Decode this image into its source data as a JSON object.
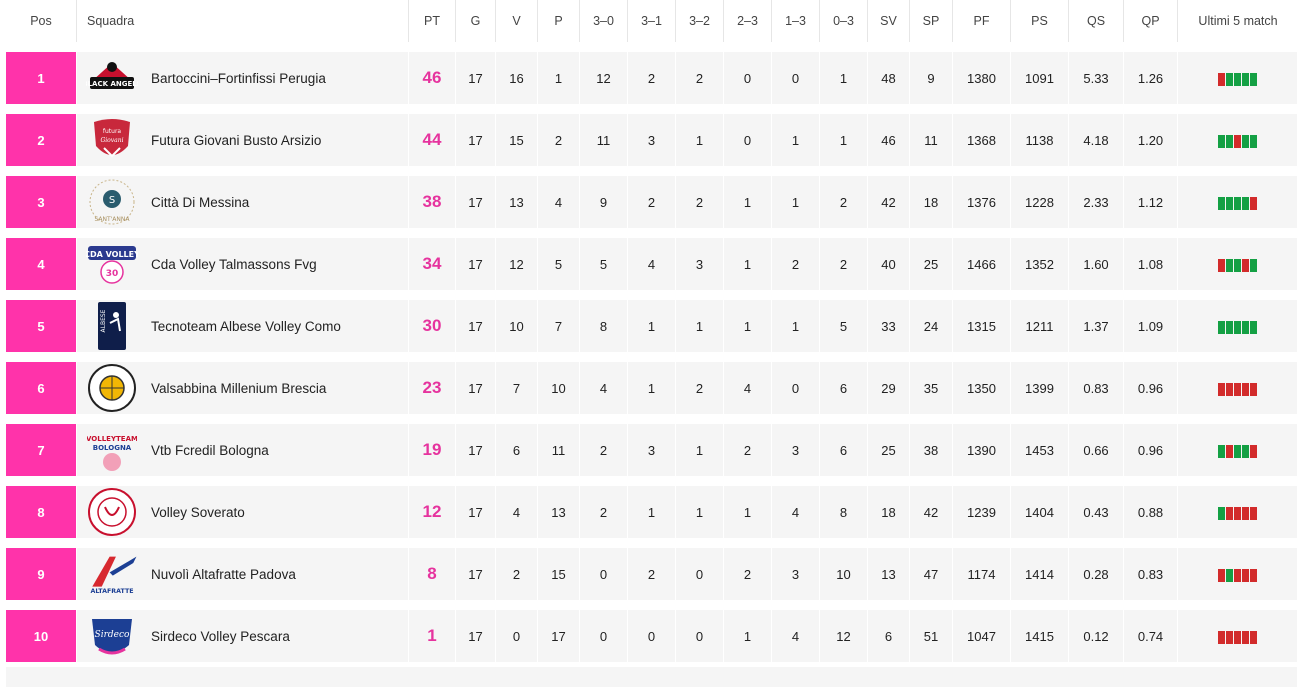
{
  "headers": {
    "pos": "Pos",
    "team": "Squadra",
    "pt": "PT",
    "g": "G",
    "v": "V",
    "p": "P",
    "s30": "3–0",
    "s31": "3–1",
    "s32": "3–2",
    "s23": "2–3",
    "s13": "1–3",
    "s03": "0–3",
    "sv": "SV",
    "sp": "SP",
    "pf": "PF",
    "ps": "PS",
    "qs": "QS",
    "qp": "QP",
    "form": "Ultimi 5 match"
  },
  "colors": {
    "accent": "#ff33aa",
    "points": "#e6339e",
    "win": "#14a044",
    "loss": "#d22b2b",
    "row_bg": "#f5f5f5"
  },
  "rows": [
    {
      "pos": "1",
      "team": "Bartoccini–Fortinfissi Perugia",
      "logo": "black-angels-logo",
      "logo_text": "BLACK ANGELS",
      "pt": "46",
      "g": "17",
      "v": "16",
      "p": "1",
      "s30": "12",
      "s31": "2",
      "s32": "2",
      "s23": "0",
      "s13": "0",
      "s03": "1",
      "sv": "48",
      "sp": "9",
      "pf": "1380",
      "ps": "1091",
      "qs": "5.33",
      "qp": "1.26",
      "form": [
        "L",
        "W",
        "W",
        "W",
        "W"
      ]
    },
    {
      "pos": "2",
      "team": "Futura Giovani Busto Arsizio",
      "logo": "futura-giovani-logo",
      "logo_text": "futura Giovani",
      "pt": "44",
      "g": "17",
      "v": "15",
      "p": "2",
      "s30": "11",
      "s31": "3",
      "s32": "1",
      "s23": "0",
      "s13": "1",
      "s03": "1",
      "sv": "46",
      "sp": "11",
      "pf": "1368",
      "ps": "1138",
      "qs": "4.18",
      "qp": "1.20",
      "form": [
        "W",
        "W",
        "L",
        "W",
        "W"
      ]
    },
    {
      "pos": "3",
      "team": "Città Di Messina",
      "logo": "akademia-sant-anna-logo",
      "logo_text": "AKADEMIA SANT'ANNA",
      "pt": "38",
      "g": "17",
      "v": "13",
      "p": "4",
      "s30": "9",
      "s31": "2",
      "s32": "2",
      "s23": "1",
      "s13": "1",
      "s03": "2",
      "sv": "42",
      "sp": "18",
      "pf": "1376",
      "ps": "1228",
      "qs": "2.33",
      "qp": "1.12",
      "form": [
        "W",
        "W",
        "W",
        "W",
        "L"
      ]
    },
    {
      "pos": "4",
      "team": "Cda Volley Talmassons Fvg",
      "logo": "cda-volley-logo",
      "logo_text": "CDA VOLLEY",
      "pt": "34",
      "g": "17",
      "v": "12",
      "p": "5",
      "s30": "5",
      "s31": "4",
      "s32": "3",
      "s23": "1",
      "s13": "2",
      "s03": "2",
      "sv": "40",
      "sp": "25",
      "pf": "1466",
      "ps": "1352",
      "qs": "1.60",
      "qp": "1.08",
      "form": [
        "L",
        "W",
        "W",
        "L",
        "W"
      ]
    },
    {
      "pos": "5",
      "team": "Tecnoteam Albese Volley Como",
      "logo": "albese-logo",
      "logo_text": "ALBESE",
      "pt": "30",
      "g": "17",
      "v": "10",
      "p": "7",
      "s30": "8",
      "s31": "1",
      "s32": "1",
      "s23": "1",
      "s13": "1",
      "s03": "5",
      "sv": "33",
      "sp": "24",
      "pf": "1315",
      "ps": "1211",
      "qs": "1.37",
      "qp": "1.09",
      "form": [
        "W",
        "W",
        "W",
        "W",
        "W"
      ]
    },
    {
      "pos": "6",
      "team": "Valsabbina Millenium Brescia",
      "logo": "millenium-brescia-logo",
      "logo_text": "VOLLEY MILLENIUM BRESCIA",
      "pt": "23",
      "g": "17",
      "v": "7",
      "p": "10",
      "s30": "4",
      "s31": "1",
      "s32": "2",
      "s23": "4",
      "s13": "0",
      "s03": "6",
      "sv": "29",
      "sp": "35",
      "pf": "1350",
      "ps": "1399",
      "qs": "0.83",
      "qp": "0.96",
      "form": [
        "L",
        "L",
        "L",
        "L",
        "L"
      ]
    },
    {
      "pos": "7",
      "team": "Vtb Fcredil Bologna",
      "logo": "volleyteam-bologna-logo",
      "logo_text": "VOLLEYTEAM BOLOGNA",
      "pt": "19",
      "g": "17",
      "v": "6",
      "p": "11",
      "s30": "2",
      "s31": "3",
      "s32": "1",
      "s23": "2",
      "s13": "3",
      "s03": "6",
      "sv": "25",
      "sp": "38",
      "pf": "1390",
      "ps": "1453",
      "qs": "0.66",
      "qp": "0.96",
      "form": [
        "W",
        "L",
        "W",
        "W",
        "L"
      ]
    },
    {
      "pos": "8",
      "team": "Volley Soverato",
      "logo": "volley-soverato-logo",
      "logo_text": "VOLLEY SOVERATO",
      "pt": "12",
      "g": "17",
      "v": "4",
      "p": "13",
      "s30": "2",
      "s31": "1",
      "s32": "1",
      "s23": "1",
      "s13": "4",
      "s03": "8",
      "sv": "18",
      "sp": "42",
      "pf": "1239",
      "ps": "1404",
      "qs": "0.43",
      "qp": "0.88",
      "form": [
        "W",
        "L",
        "L",
        "L",
        "L"
      ]
    },
    {
      "pos": "9",
      "team": "Nuvolì Altafratte Padova",
      "logo": "altafratte-logo",
      "logo_text": "ALTAFRATTE",
      "pt": "8",
      "g": "17",
      "v": "2",
      "p": "15",
      "s30": "0",
      "s31": "2",
      "s32": "0",
      "s23": "2",
      "s13": "3",
      "s03": "10",
      "sv": "13",
      "sp": "47",
      "pf": "1174",
      "ps": "1414",
      "qs": "0.28",
      "qp": "0.83",
      "form": [
        "L",
        "W",
        "L",
        "L",
        "L"
      ]
    },
    {
      "pos": "10",
      "team": "Sirdeco Volley Pescara",
      "logo": "sirdeco-pescara-logo",
      "logo_text": "Sirdeco",
      "pt": "1",
      "g": "17",
      "v": "0",
      "p": "17",
      "s30": "0",
      "s31": "0",
      "s32": "0",
      "s23": "1",
      "s13": "4",
      "s03": "12",
      "sv": "6",
      "sp": "51",
      "pf": "1047",
      "ps": "1415",
      "qs": "0.12",
      "qp": "0.74",
      "form": [
        "L",
        "L",
        "L",
        "L",
        "L"
      ]
    }
  ]
}
